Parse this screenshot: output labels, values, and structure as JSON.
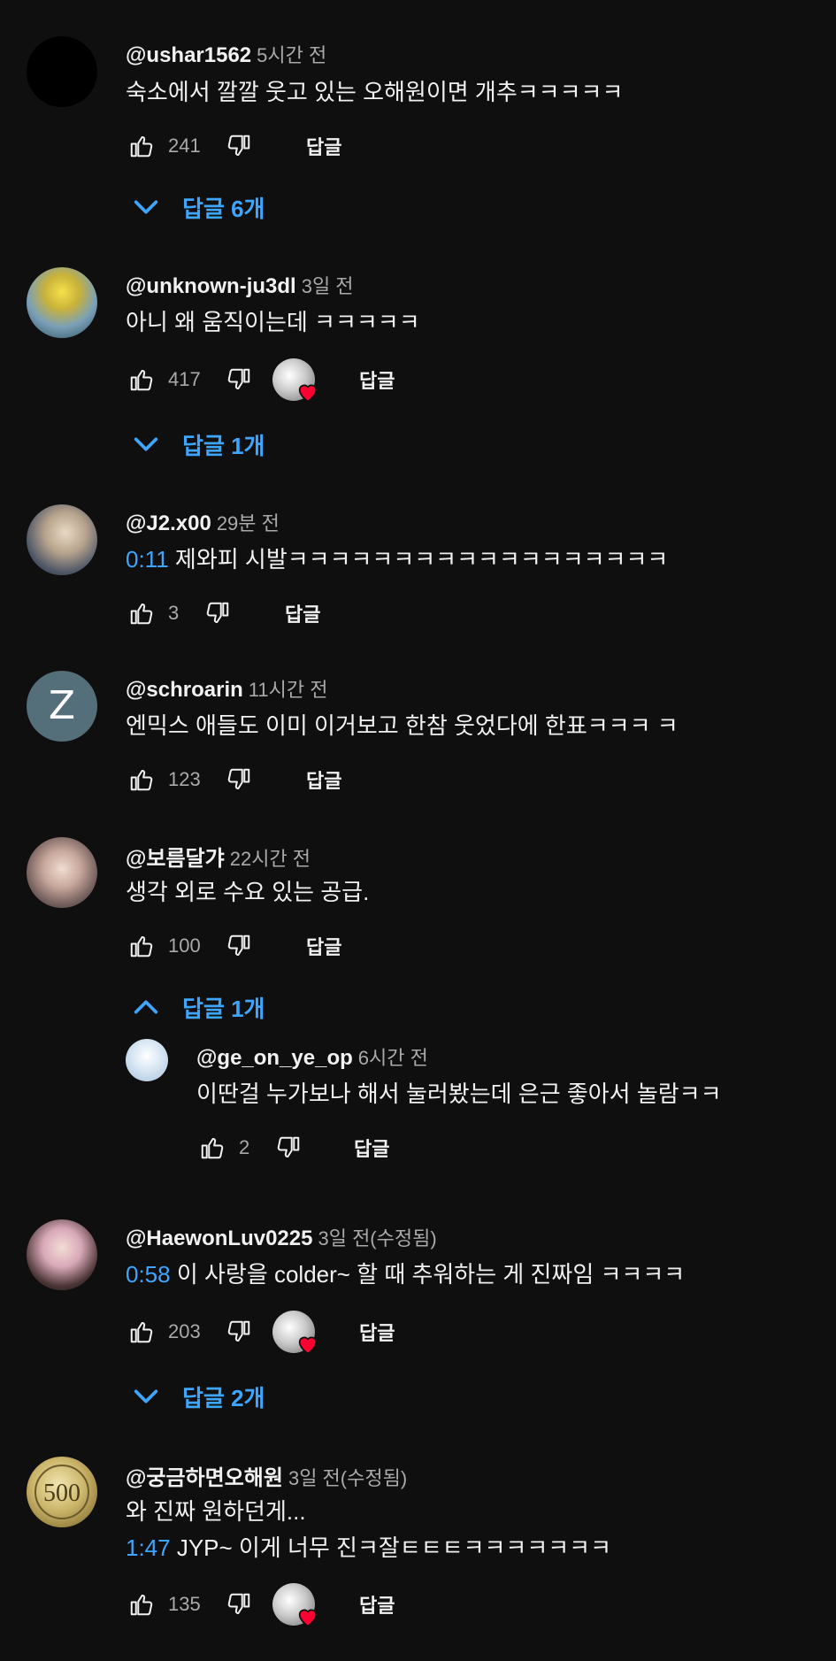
{
  "reply_label": "답글",
  "comments": [
    {
      "author": "@ushar1562",
      "time": "5시간 전",
      "text": "숙소에서 깔깔 웃고 있는 오해원이면 개추ㅋㅋㅋㅋㅋ",
      "likes": "241",
      "replies_toggle": "답글 6개"
    },
    {
      "author": "@unknown-ju3dl",
      "time": "3일 전",
      "text": "아니 왜 움직이는데 ㅋㅋㅋㅋㅋ",
      "likes": "417",
      "replies_toggle": "답글 1개"
    },
    {
      "author": "@J2.x00",
      "time": "29분 전",
      "timestamp": "0:11",
      "text": " 제와피 시발ㅋㅋㅋㅋㅋㅋㅋㅋㅋㅋㅋㅋㅋㅋㅋㅋㅋㅋ",
      "likes": "3"
    },
    {
      "author": "@schroarin",
      "time": "11시간 전",
      "initial": "Z",
      "text": "엔믹스 애들도 이미 이거보고 한참 웃었다에 한표ㅋㅋㅋ ㅋ",
      "likes": "123"
    },
    {
      "author": "@보름달갸",
      "time": "22시간 전",
      "text": "생각 외로 수요 있는 공급.",
      "likes": "100",
      "replies_toggle": "답글 1개",
      "reply": {
        "author": "@ge_on_ye_op",
        "time": "6시간 전",
        "text": "이딴걸 누가보나 해서 눌러봤는데 은근 좋아서 놀람ㅋㅋ",
        "likes": "2"
      }
    },
    {
      "author": "@HaewonLuv0225",
      "time": "3일 전(수정됨)",
      "timestamp": "0:58",
      "text": " 이 사랑을 colder~ 할 때 추워하는 게 진짜임 ㅋㅋㅋㅋ",
      "likes": "203",
      "replies_toggle": "답글 2개"
    },
    {
      "author": "@궁금하면오해원",
      "time": "3일 전(수정됨)",
      "text": "와 진짜 원하던게...",
      "timestamp2": "1:47",
      "text2": " JYP~ 이게 너무 진ㅋ잘ㅌㅌㅌㅋㅋㅋㅋㅋㅋㅋ",
      "likes": "135",
      "coin_text": "500"
    }
  ],
  "colors": {
    "background": "#0f0f0f",
    "link": "#3ea6ff",
    "secondary": "#aaaaaa",
    "heart": "#ff0033"
  }
}
